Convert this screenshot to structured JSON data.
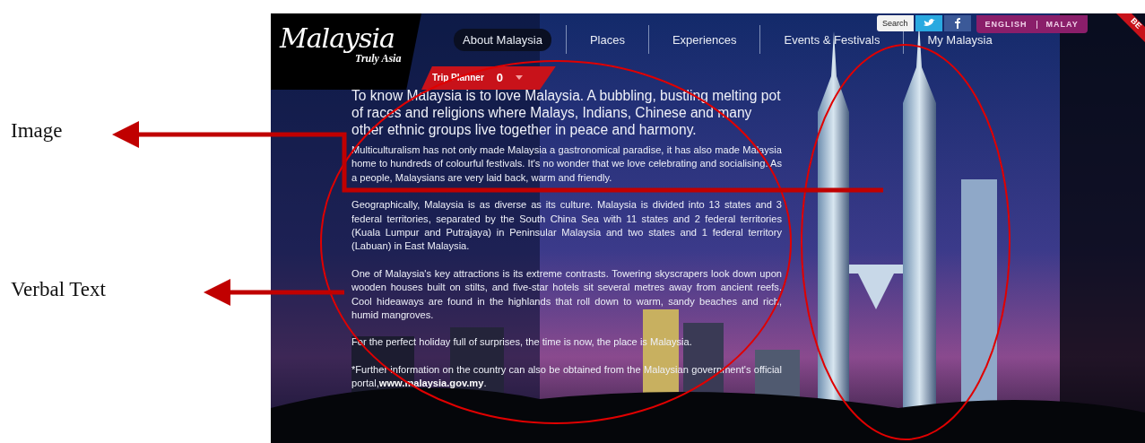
{
  "figure_labels": [
    {
      "text": "Image"
    },
    {
      "text": "Verbal Text"
    }
  ],
  "site": {
    "logo": {
      "name": "Malaysia",
      "tagline": "Truly Asia"
    },
    "nav": [
      {
        "label": "About Malaysia",
        "selected": true
      },
      {
        "label": "Places",
        "selected": false
      },
      {
        "label": "Experiences",
        "selected": false
      },
      {
        "label": "Events & Festivals",
        "selected": false
      },
      {
        "label": "My Malaysia",
        "selected": false
      }
    ],
    "trip_planner": {
      "label": "Trip Planner",
      "count": "0"
    },
    "search": {
      "label": "Search"
    },
    "languages": [
      "ENGLISH",
      "MALAY"
    ],
    "corner_ribbon": "BE",
    "lead": "To know Malaysia is to love Malaysia. A bubbling, bustling melting pot of races and religions where Malays, Indians, Chinese and many other ethnic groups live together in peace and harmony.",
    "paragraphs": [
      "Multiculturalism has not only made Malaysia a gastronomical paradise, it has also made Malaysia home to hundreds of colourful festivals. It's no wonder that we love celebrating and socialising. As a people, Malaysians are very laid back, warm and friendly.",
      "Geographically, Malaysia is as diverse as its culture. Malaysia is divided into 13 states and 3 federal territories, separated by the South China Sea with 11 states and 2 federal territories (Kuala Lumpur and Putrajaya) in Peninsular Malaysia and two states and 1 federal territory (Labuan) in East Malaysia.",
      "One of Malaysia's key attractions is its extreme contrasts. Towering skyscrapers look down upon wooden houses built on stilts, and five-star hotels sit several metres away from ancient reefs. Cool hideaways are found in the highlands that roll down to warm, sandy beaches and rich, humid mangroves.",
      "For the perfect holiday full of surprises, the time is now, the place is Malaysia."
    ],
    "footnote": {
      "text": "*Further information on the country can also be obtained from the Malaysian government's official portal,",
      "link": "www.malaysia.gov.my",
      "end": "."
    }
  }
}
